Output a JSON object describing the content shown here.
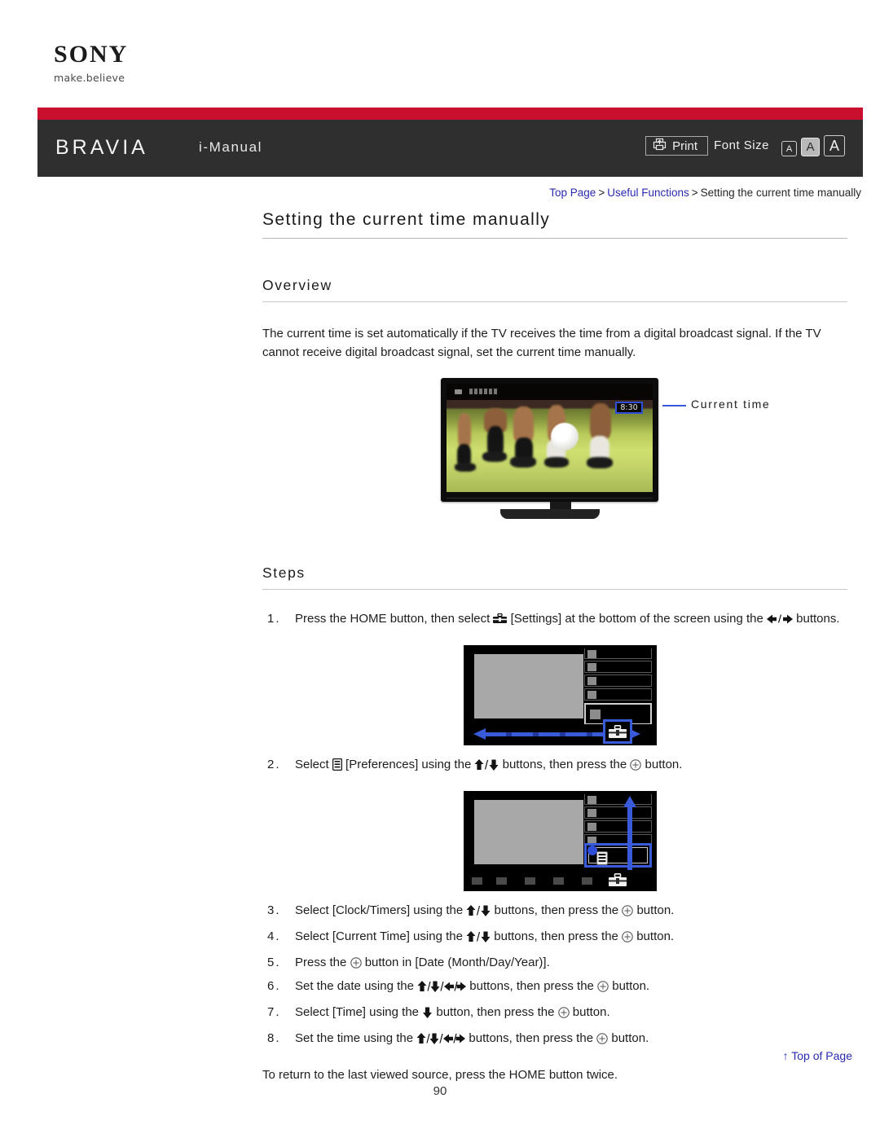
{
  "brand": {
    "logo_text": "SONY",
    "tagline": "make.believe",
    "product": "BRAVIA",
    "manual": "i-Manual"
  },
  "header": {
    "print_label": "Print",
    "print_icon": "printer-icon",
    "font_size_label": "Font Size",
    "font_sizes": [
      {
        "label": "A",
        "size": "small",
        "selected": false
      },
      {
        "label": "A",
        "size": "medium",
        "selected": true
      },
      {
        "label": "A",
        "size": "large",
        "selected": false
      }
    ],
    "colors": {
      "red_bar": "#c8102e",
      "header_bg": "#2f2f2f",
      "link": "#2a2ab0"
    }
  },
  "breadcrumb": {
    "items": [
      {
        "label": "Top Page",
        "link": true
      },
      {
        "label": "Useful Functions",
        "link": true
      },
      {
        "label": "Setting the current time manually",
        "link": false
      }
    ],
    "separator": ">"
  },
  "page": {
    "title": "Setting the current time manually",
    "page_number": "90"
  },
  "overview": {
    "heading": "Overview",
    "paragraph": "The current time is set automatically if the TV receives the time from a digital broadcast signal. If the TV cannot receive digital broadcast signal, set the current time manually."
  },
  "tv_figure": {
    "clock_value": "8:30",
    "callout_label": "Current time",
    "callout_color": "#3a5bd9"
  },
  "steps_section": {
    "heading": "Steps",
    "items": [
      {
        "number": "1.",
        "parts": [
          {
            "t": "text",
            "v": "Press the HOME button, then select "
          },
          {
            "t": "icon",
            "v": "settings-toolbox-icon"
          },
          {
            "t": "text",
            "v": " [Settings] at the bottom of the screen using the "
          },
          {
            "t": "icon",
            "v": "arrow-left-right-icon"
          },
          {
            "t": "text",
            "v": " buttons."
          }
        ]
      },
      {
        "number": "2.",
        "parts": [
          {
            "t": "text",
            "v": "Select "
          },
          {
            "t": "icon",
            "v": "preferences-icon"
          },
          {
            "t": "text",
            "v": " [Preferences] using the "
          },
          {
            "t": "icon",
            "v": "arrow-up-down-icon"
          },
          {
            "t": "text",
            "v": " buttons, then press the "
          },
          {
            "t": "icon",
            "v": "enter-button-icon"
          },
          {
            "t": "text",
            "v": " button."
          }
        ]
      },
      {
        "number": "3.",
        "parts": [
          {
            "t": "text",
            "v": "Select [Clock/Timers] using the "
          },
          {
            "t": "icon",
            "v": "arrow-up-down-icon"
          },
          {
            "t": "text",
            "v": " buttons, then press the "
          },
          {
            "t": "icon",
            "v": "enter-button-icon"
          },
          {
            "t": "text",
            "v": " button."
          }
        ]
      },
      {
        "number": "4.",
        "parts": [
          {
            "t": "text",
            "v": "Select [Current Time] using the "
          },
          {
            "t": "icon",
            "v": "arrow-up-down-icon"
          },
          {
            "t": "text",
            "v": " buttons, then press the "
          },
          {
            "t": "icon",
            "v": "enter-button-icon"
          },
          {
            "t": "text",
            "v": " button."
          }
        ]
      },
      {
        "number": "5.",
        "parts": [
          {
            "t": "text",
            "v": "Press the "
          },
          {
            "t": "icon",
            "v": "enter-button-icon"
          },
          {
            "t": "text",
            "v": " button in [Date (Month/Day/Year)]."
          }
        ]
      },
      {
        "number": "6.",
        "parts": [
          {
            "t": "text",
            "v": "Set the date using the "
          },
          {
            "t": "icon",
            "v": "arrow-four-way-icon"
          },
          {
            "t": "text",
            "v": " buttons, then press the "
          },
          {
            "t": "icon",
            "v": "enter-button-icon"
          },
          {
            "t": "text",
            "v": " button."
          }
        ]
      },
      {
        "number": "7.",
        "parts": [
          {
            "t": "text",
            "v": "Select [Time] using the "
          },
          {
            "t": "icon",
            "v": "arrow-down-icon"
          },
          {
            "t": "text",
            "v": " button, then press the "
          },
          {
            "t": "icon",
            "v": "enter-button-icon"
          },
          {
            "t": "text",
            "v": " button."
          }
        ]
      },
      {
        "number": "8.",
        "parts": [
          {
            "t": "text",
            "v": "Set the time using the "
          },
          {
            "t": "icon",
            "v": "arrow-four-way-icon"
          },
          {
            "t": "text",
            "v": " buttons, then press the "
          },
          {
            "t": "icon",
            "v": "enter-button-icon"
          },
          {
            "t": "text",
            "v": " button."
          }
        ]
      }
    ],
    "closing_note": "To return to the last viewed source, press the HOME button twice."
  },
  "footer": {
    "top_of_page": "Top of Page",
    "top_of_page_icon": "arrow-up-icon"
  }
}
